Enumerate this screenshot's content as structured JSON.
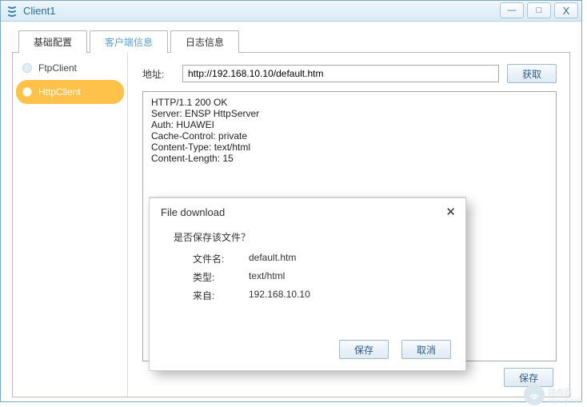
{
  "window": {
    "title": "Client1",
    "controls": {
      "min": "—",
      "max": "□",
      "close": "X"
    }
  },
  "tabs": [
    {
      "label": "基础配置"
    },
    {
      "label": "客户端信息"
    },
    {
      "label": "日志信息"
    }
  ],
  "sidebar": {
    "items": [
      {
        "label": "FtpClient"
      },
      {
        "label": "HttpClient"
      }
    ]
  },
  "address": {
    "label": "地址:",
    "value": "http://192.168.10.10/default.htm",
    "fetch_label": "获取"
  },
  "response_text": "HTTP/1.1 200 OK\nServer: ENSP HttpServer\nAuth: HUAWEI\nCache-Control: private\nContent-Type: text/html\nContent-Length: 15",
  "footer": {
    "save_label": "保存"
  },
  "dialog": {
    "title": "File download",
    "close": "✕",
    "question": "是否保存该文件？",
    "rows": [
      {
        "k": "文件名:",
        "v": "default.htm"
      },
      {
        "k": "类型:",
        "v": "text/html"
      },
      {
        "k": "来自:",
        "v": "192.168.10.10"
      }
    ],
    "save": "保存",
    "cancel": "取消"
  },
  "watermark": {
    "text": "路由器",
    "sub": "luyouqi.com"
  }
}
